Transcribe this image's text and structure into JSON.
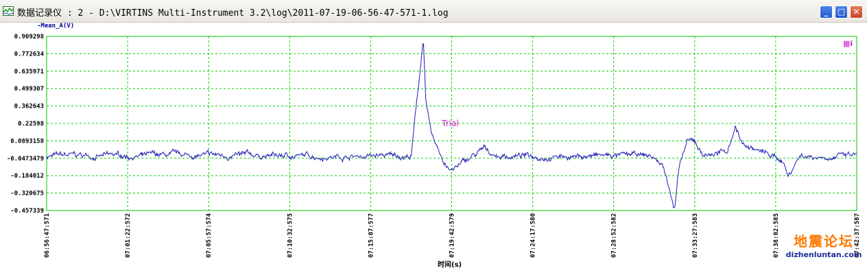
{
  "window": {
    "title": "数据记录仪 : 2 - D:\\VIRTINS Multi-Instrument 3.2\\log\\2011-07-19-06-56-47-571-1.log",
    "app_icon": "chart-app-icon",
    "minimize_icon": "minimize-icon",
    "maximize_icon": "maximize-icon",
    "close_icon": "close-icon"
  },
  "plot": {
    "series_label": "-Mean_A(V)",
    "xlabel": "时间(s)",
    "legend_mark": "▦i",
    "annotation": "Trial",
    "colors": {
      "trace": "#1c1cb4",
      "grid": "#00d000",
      "frame": "#00c800",
      "annotation": "#cc22cc",
      "legend": "#cc22cc"
    }
  },
  "watermark": {
    "site_name": "地震论坛",
    "url": "dizhenluntan.com"
  },
  "chart_data": {
    "type": "line",
    "ylabel": "-Mean_A(V)",
    "xlabel": "时间(s)",
    "ylim": [
      -0.457339,
      0.909298
    ],
    "y_ticks": [
      "0.909298",
      "0.772634",
      "0.635971",
      "0.499307",
      "0.362643",
      "0.22598",
      "0.0893158",
      "-0.0473479",
      "-0.184012",
      "-0.320675",
      "-0.457339"
    ],
    "x_ticks": [
      "06:56:47:571",
      "07:01:22:572",
      "07:05:57:574",
      "07:10:32:575",
      "07:15:07:577",
      "07:19:42:579",
      "07:24:17:580",
      "07:28:52:582",
      "07:33:27:583",
      "07:38:02:585",
      "07:42:37:587"
    ],
    "grid": true,
    "annotation": "Trial",
    "series": [
      {
        "baseline": -0.03,
        "noise": 0.025,
        "events": [
          {
            "t": 0.465,
            "value": 0.9
          },
          {
            "t": 0.468,
            "value": 0.4
          },
          {
            "t": 0.475,
            "value": 0.12
          },
          {
            "t": 0.49,
            "value": -0.07
          },
          {
            "t": 0.5,
            "value": -0.15
          },
          {
            "t": 0.51,
            "value": -0.1
          },
          {
            "t": 0.54,
            "value": 0.02
          },
          {
            "t": 0.76,
            "value": -0.1
          },
          {
            "t": 0.77,
            "value": -0.3
          },
          {
            "t": 0.775,
            "value": -0.44
          },
          {
            "t": 0.78,
            "value": -0.15
          },
          {
            "t": 0.79,
            "value": 0.07
          },
          {
            "t": 0.8,
            "value": 0.08
          },
          {
            "t": 0.81,
            "value": -0.02
          },
          {
            "t": 0.84,
            "value": 0.0
          },
          {
            "t": 0.85,
            "value": 0.2
          },
          {
            "t": 0.86,
            "value": 0.06
          },
          {
            "t": 0.91,
            "value": -0.07
          },
          {
            "t": 0.915,
            "value": -0.19
          },
          {
            "t": 0.93,
            "value": -0.02
          }
        ]
      }
    ]
  }
}
